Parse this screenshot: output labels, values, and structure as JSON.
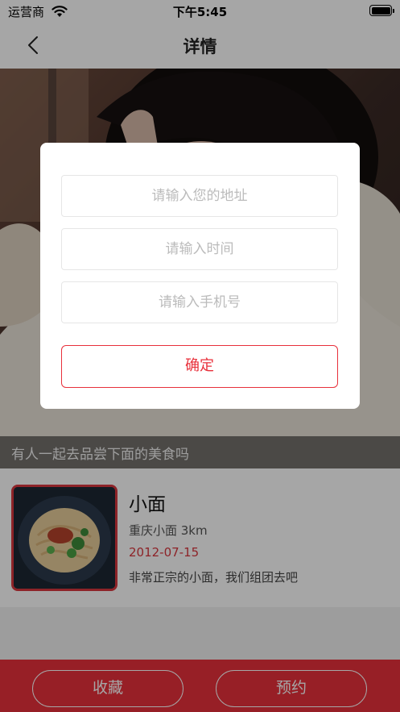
{
  "status_bar": {
    "carrier": "运营商",
    "time": "下午5:45"
  },
  "nav": {
    "title": "详情"
  },
  "hero": {
    "caption": "有人一起去品尝下面的美食吗"
  },
  "food": {
    "name": "小面",
    "sub": "重庆小面 3km",
    "date": "2012-07-15",
    "desc": "非常正宗的小面，我们组团去吧"
  },
  "dialog": {
    "address_placeholder": "请输入您的地址",
    "time_placeholder": "请输入时间",
    "phone_placeholder": "请输入手机号",
    "confirm_label": "确定"
  },
  "bottom_bar": {
    "favorite_label": "收藏",
    "booking_label": "预约"
  },
  "colors": {
    "accent": "#e8303b",
    "date_red": "#d9363e"
  }
}
